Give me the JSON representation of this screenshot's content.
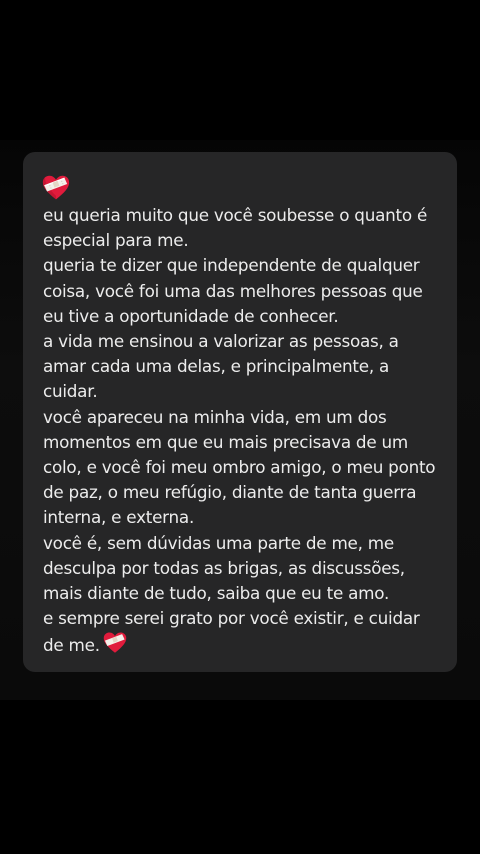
{
  "note": {
    "paragraphs": [
      "eu queria muito que você soubesse o quanto é especial para me.",
      "queria te dizer que independente de qualquer coisa, você foi uma das melhores pessoas que eu tive a oportunidade de conhecer.",
      "a vida me ensinou a valorizar as pessoas, a amar cada uma delas, e principalmente, a cuidar.",
      "você apareceu na minha vida, em um dos momentos em que eu mais precisava de um colo, e você foi meu ombro amigo, o meu ponto de paz, o meu refúgio, diante de tanta guerra interna, e externa.",
      "você é, sem dúvidas uma parte de me, me desculpa por todas as brigas, as discussões, mais diante de tudo, saiba que eu te amo."
    ],
    "last_paragraph": "e sempre serei grato por você existir, e cuidar de me.",
    "icons": {
      "top": "mending-heart-icon",
      "end": "mending-heart-icon"
    },
    "colors": {
      "card_background": "#262627",
      "text": "#ececec",
      "heart": "#e01b3c",
      "bandage": "#f4f0ea"
    }
  }
}
